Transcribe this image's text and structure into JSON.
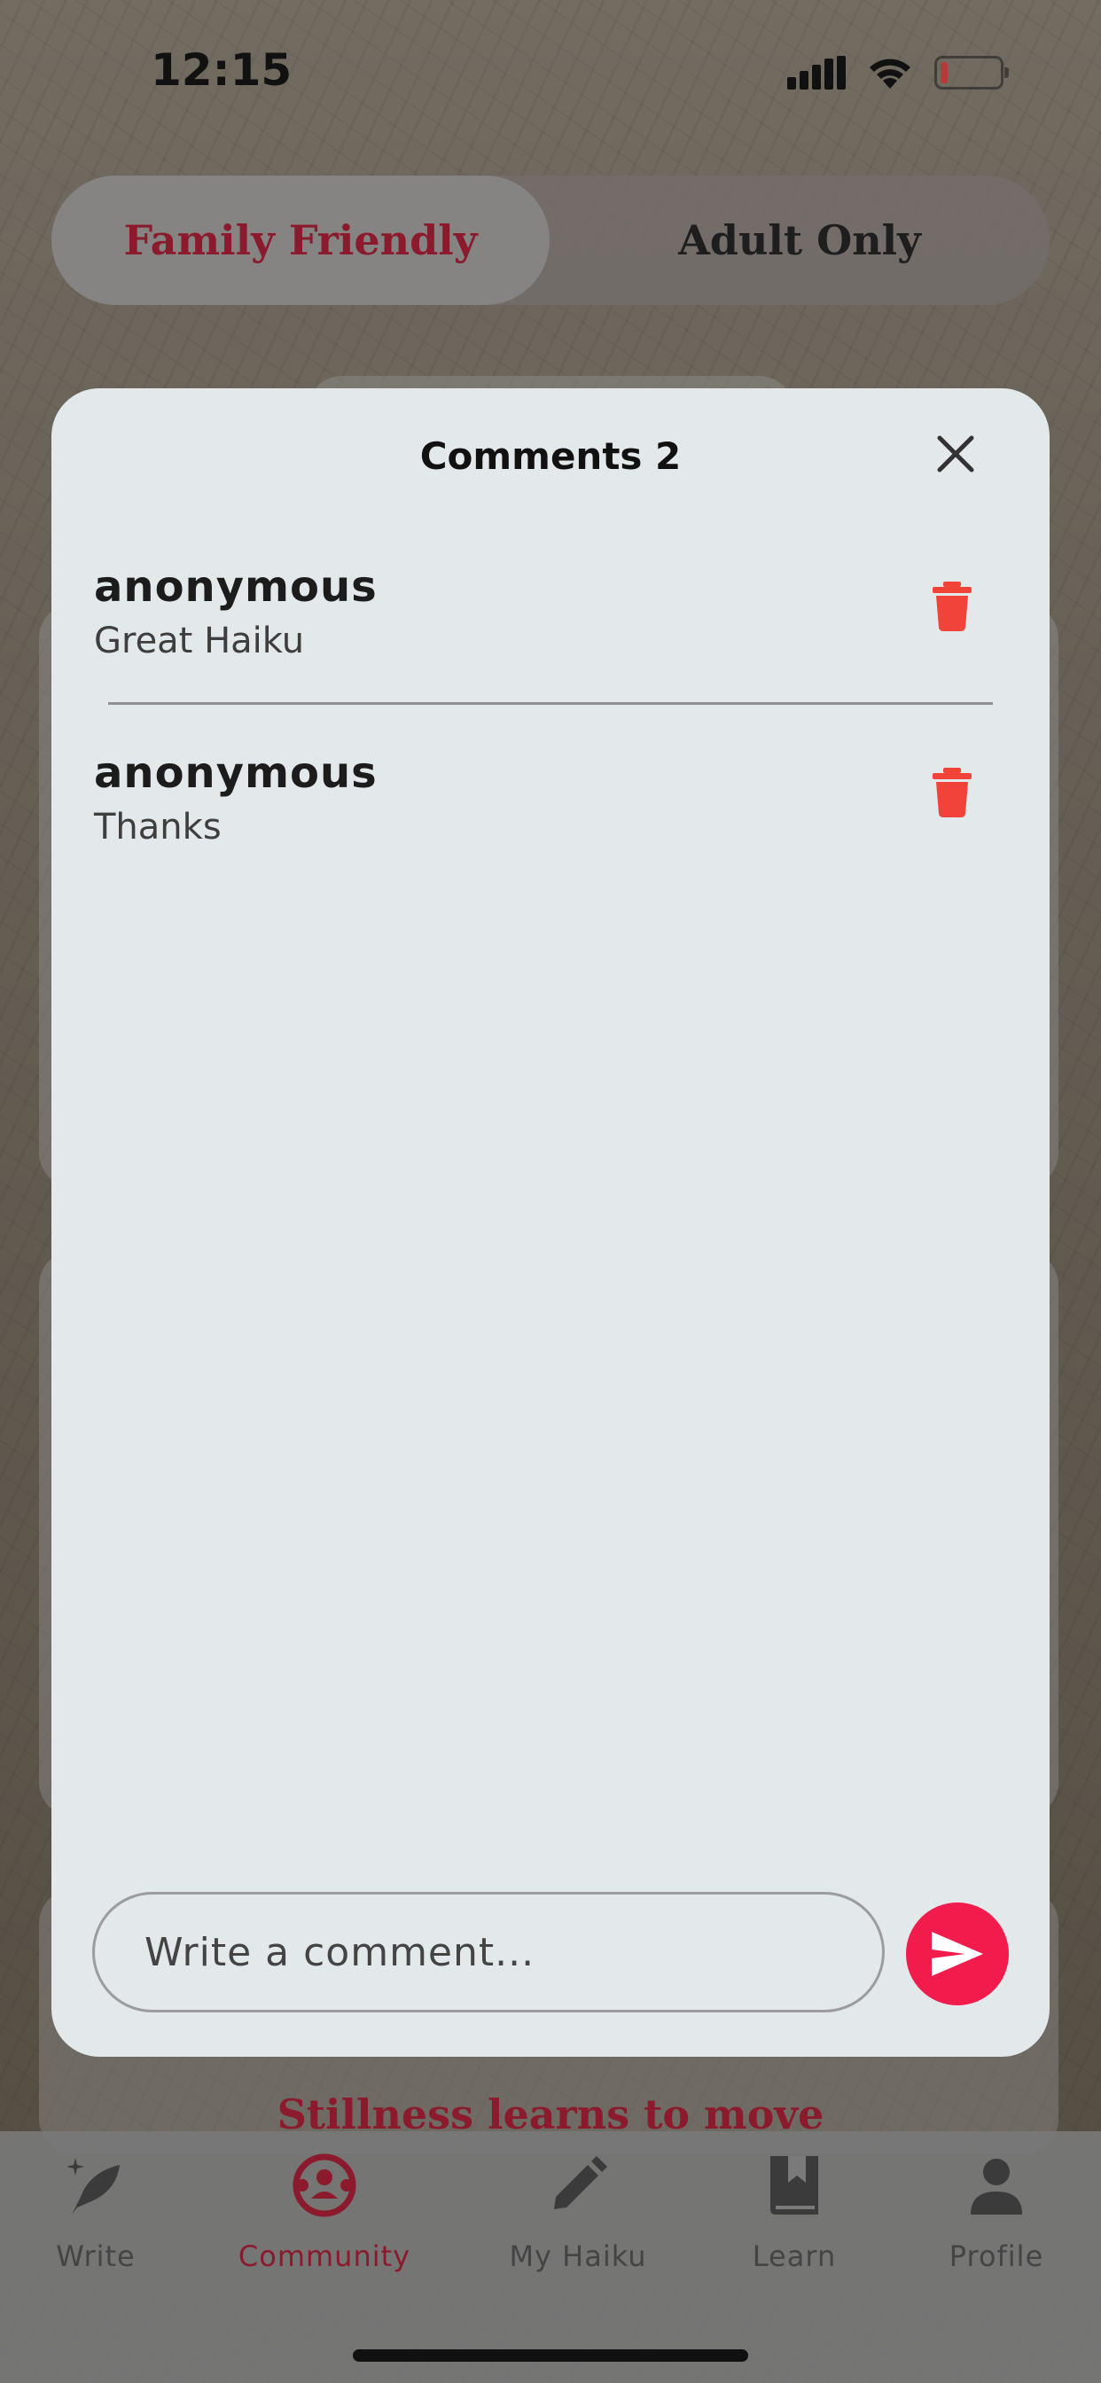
{
  "status_bar": {
    "time": "12:15"
  },
  "segmented_control": {
    "options": [
      "Family Friendly",
      "Adult Only"
    ],
    "selected": "Family Friendly"
  },
  "modal": {
    "title": "Comments 2",
    "comments": [
      {
        "user": "anonymous",
        "text": "Great Haiku"
      },
      {
        "user": "anonymous",
        "text": "Thanks"
      }
    ],
    "input_placeholder": "Write a comment..."
  },
  "background_text": "Stillness learns to move",
  "bottom_nav": {
    "items": [
      {
        "label": "Write",
        "icon": "quill-icon"
      },
      {
        "label": "Community",
        "icon": "community-icon"
      },
      {
        "label": "My Haiku",
        "icon": "pencil-icon"
      },
      {
        "label": "Learn",
        "icon": "book-icon"
      },
      {
        "label": "Profile",
        "icon": "person-icon"
      }
    ],
    "active": "Community"
  },
  "colors": {
    "accent": "#8a1a2c",
    "send": "#f21c4c",
    "delete": "#f2433a",
    "modal_bg": "#e3e8eb"
  }
}
